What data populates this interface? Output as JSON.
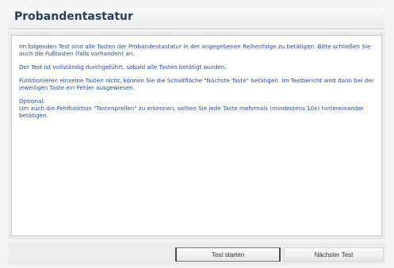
{
  "window": {
    "title": "Probandentastatur"
  },
  "instructions": {
    "paragraph1": "Im folgenden Test sind alle Tasten der Probandentastatur in der angegebenen Reihenfolge zu betätigen. Bitte schließen Sie auch die Fußtasten (falls vorhanden) an.",
    "paragraph2": "Der Test ist vollständig durchgeführt, sobald alle Tasten betätigt wurden.",
    "paragraph3": "Funktionieren einzelne Tasten nicht, können Sie die Schaltfläche \"Nächste Taste\" betätigen. Im Testbericht wird dann bei der jeweiligen Taste ein Fehler ausgewiesen.",
    "optional_heading": "Optional:",
    "optional_text": "Um auch die Fehlfunktion \"Tastenprellen\" zu erkennen, sollten Sie jede Taste mehrmals (mindestens 10x) hintereinander betätigen."
  },
  "footer": {
    "start_label": "Test starten",
    "next_label": "Nächster Test"
  },
  "colors": {
    "title": "#2a3e5a",
    "text": "#1f4ea6",
    "background": "#f4f4f4"
  }
}
